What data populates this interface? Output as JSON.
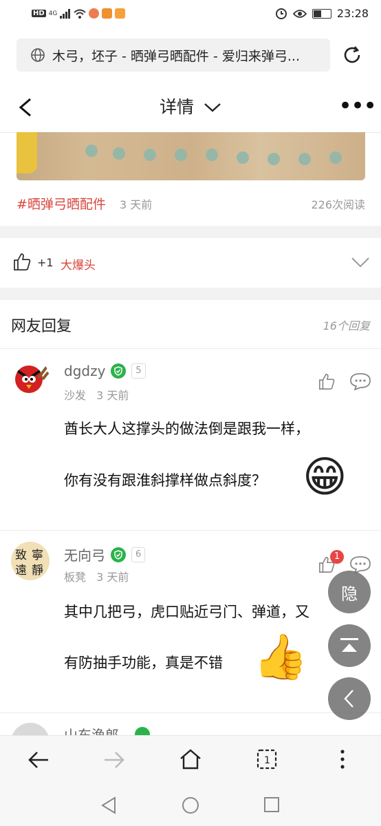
{
  "status_bar": {
    "time": "23:28",
    "net": "4G",
    "hd": "HD",
    "colors": {
      "chip1": "#ee7b51",
      "chip2": "#f0902f",
      "chip3": "#f5a23a"
    }
  },
  "browser": {
    "url_title": "木弓，坯子 - 晒弹弓晒配件 - 爱归来弹弓...",
    "icons": [
      "globe-icon",
      "refresh-icon"
    ]
  },
  "header": {
    "title": "详情",
    "title_suffix": "∨",
    "more": "•••"
  },
  "post": {
    "tag": "#晒弹弓晒配件",
    "posted_ago": "3 天前",
    "reads": "226次阅读"
  },
  "like_bar": {
    "plus": "+1",
    "liker": "大爆头"
  },
  "replies": {
    "title": "网友回复",
    "count": "16个回复"
  },
  "comments": [
    {
      "user": "dgdzy",
      "level": "5",
      "floor": "沙发",
      "time": "3 天前",
      "lines": [
        "酋长大人这撑头的做法倒是跟我一样，",
        "你有没有跟淮斜撑样做点斜度？"
      ],
      "emoji": "😁"
    },
    {
      "user": "无向弓",
      "level": "6",
      "floor": "板凳",
      "time": "3 天前",
      "like_count": "1",
      "lines": [
        "其中几把弓，虎口贴近弓门、弹道，又",
        "有防抽手功能，真是不错"
      ],
      "emoji": "👍"
    },
    {
      "user": "山东渔郎"
    }
  ],
  "floating": {
    "hide_label": "隐"
  },
  "accent_color": "#d8463d",
  "badge_color": "#2bb24c"
}
